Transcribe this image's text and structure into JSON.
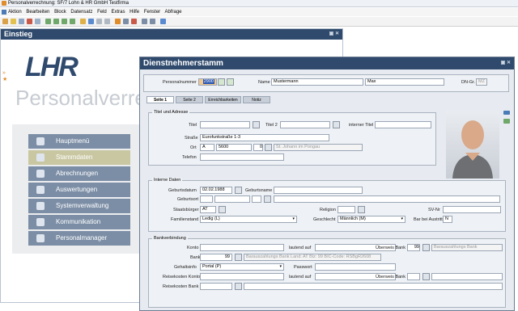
{
  "window": {
    "title": "Personalverrechnung: SF/7 Lohn & HR GmbH Testfirma"
  },
  "menu": [
    "Aktion",
    "Bearbeiten",
    "Block",
    "Datensatz",
    "Feld",
    "Extras",
    "Hilfe",
    "Fenster",
    "Abfrage"
  ],
  "einstieg": {
    "title": "Einstieg",
    "logo": "LHR",
    "subtitle": "Personalverre",
    "nav": [
      "Hauptmenü",
      "Stammdaten",
      "Abrechnungen",
      "Auswertungen",
      "Systemverwaltung",
      "Kommunikation",
      "Personalmanager"
    ]
  },
  "dialog": {
    "title": "Dienstnehmerstamm",
    "personalnummer_label": "Personalnummer",
    "personalnummer": "2900",
    "name_label": "Name",
    "last_name": "Mustermann",
    "first_name": "Max",
    "dngr_label": "DN-Gr.",
    "dngr": "MZ",
    "tabs": [
      "Seite 1",
      "Seite 2",
      "Erreichbarkeiten",
      "Notiz"
    ],
    "titel_adresse": {
      "group": "Titel und Adresse",
      "titel_label": "Titel",
      "titel2_label": "Titel 2",
      "internal_label": "interner Titel",
      "strasse_label": "Straße",
      "strasse": "Eurofunkstraße 1-3",
      "ort_label": "Ort",
      "country": "A",
      "plz": "5600",
      "plz_code": "0",
      "ort": "St. Johann im Pongau",
      "telefon_label": "Telefon"
    },
    "interne": {
      "group": "Interne Daten",
      "geburtsdatum_label": "Geburtsdatum",
      "geburtsdatum": "02.02.1988",
      "geburtsname_label": "Geburtsname",
      "geburtsort_label": "Geburtsort",
      "staatsburger_label": "Staatsbürger",
      "staatsburger": "AT",
      "religion_label": "Religion",
      "svnr_label": "SV-Nr",
      "familienstand_label": "Familienstand",
      "familienstand": "Ledig (L)",
      "geschlecht_label": "Geschlecht",
      "geschlecht": "Männlich (M)",
      "bar_label": "Bar bei Austritt",
      "bar": "N"
    },
    "bank": {
      "group": "Bankverbindung",
      "konto_label": "Konto",
      "lautend_label": "lautend auf",
      "uberweis_label": "Überweis Bank",
      "uberweis_code": "99",
      "uberweis_value": "Barauszahlungs Bank",
      "bank_label": "Bank",
      "bank_code": "99",
      "bank_value": "Barauszahlungs Bank Land: AT Blz: 99 BIC-Code: RSBgR2608",
      "gehaltsinfo_label": "Gehaltsinfo",
      "gehaltsinfo": "Portal (P)",
      "passwort_label": "Passwort",
      "reisekonto_label": "Reisekosten Konto",
      "reise_lautend_label": "lautend auf",
      "reise_uberweis_label": "Überweis Bank",
      "reisebank_label": "Reisekosten Bank"
    }
  },
  "colors": {
    "accent": "#2f4a6d",
    "orange": "#e08c2a",
    "nav": "#7c8ea6"
  }
}
